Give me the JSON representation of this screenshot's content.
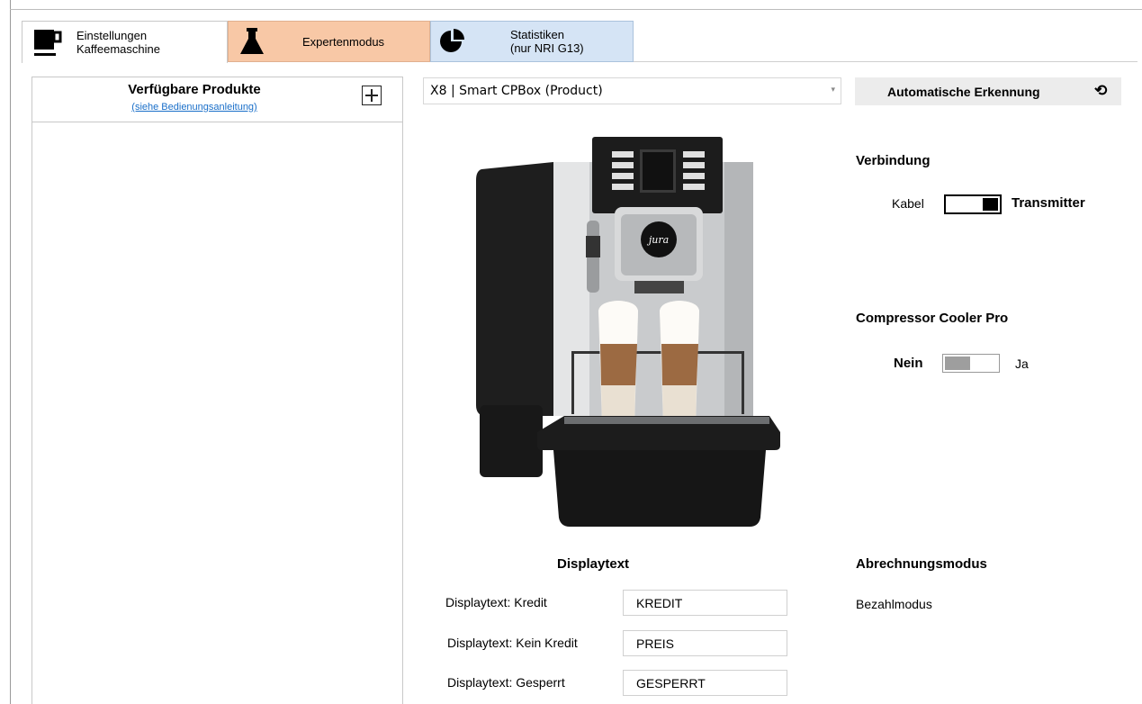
{
  "tabs": [
    {
      "label": "Einstellungen\nKaffeemaschine",
      "icon": "coffee-cup-icon",
      "active": true
    },
    {
      "label": "Expertenmodus",
      "icon": "flask-icon",
      "color": "#f8c8a6"
    },
    {
      "label": "Statistiken\n(nur NRI G13)",
      "icon": "pie-chart-icon",
      "color": "#d5e4f5"
    }
  ],
  "products": {
    "title": "Verfügbare Produkte",
    "link": "(siehe Bedienungsanleitung)",
    "add_icon": "plus-icon"
  },
  "machine_select": {
    "value": "X8 | Smart CPBox (Product)"
  },
  "auto_detect": {
    "label": "Automatische Erkennung",
    "icon": "refresh-icon"
  },
  "connection": {
    "title": "Verbindung",
    "left_label": "Kabel",
    "right_label": "Transmitter",
    "selected": "Transmitter"
  },
  "cooler": {
    "title": "Compressor Cooler Pro",
    "left_label": "Nein",
    "right_label": "Ja",
    "selected": "Nein"
  },
  "display_text": {
    "title": "Displaytext",
    "rows": [
      {
        "label": "Displaytext: Kredit",
        "value": "KREDIT"
      },
      {
        "label": "Displaytext: Kein Kredit",
        "value": "PREIS"
      },
      {
        "label": "Displaytext: Gesperrt",
        "value": "GESPERRT"
      }
    ]
  },
  "billing": {
    "title": "Abrechnungsmodus",
    "mode": "Bezahlmodus"
  },
  "colors": {
    "expert_tab": "#f8c8a6",
    "stats_tab": "#d5e4f5",
    "link": "#1a6fc9"
  }
}
